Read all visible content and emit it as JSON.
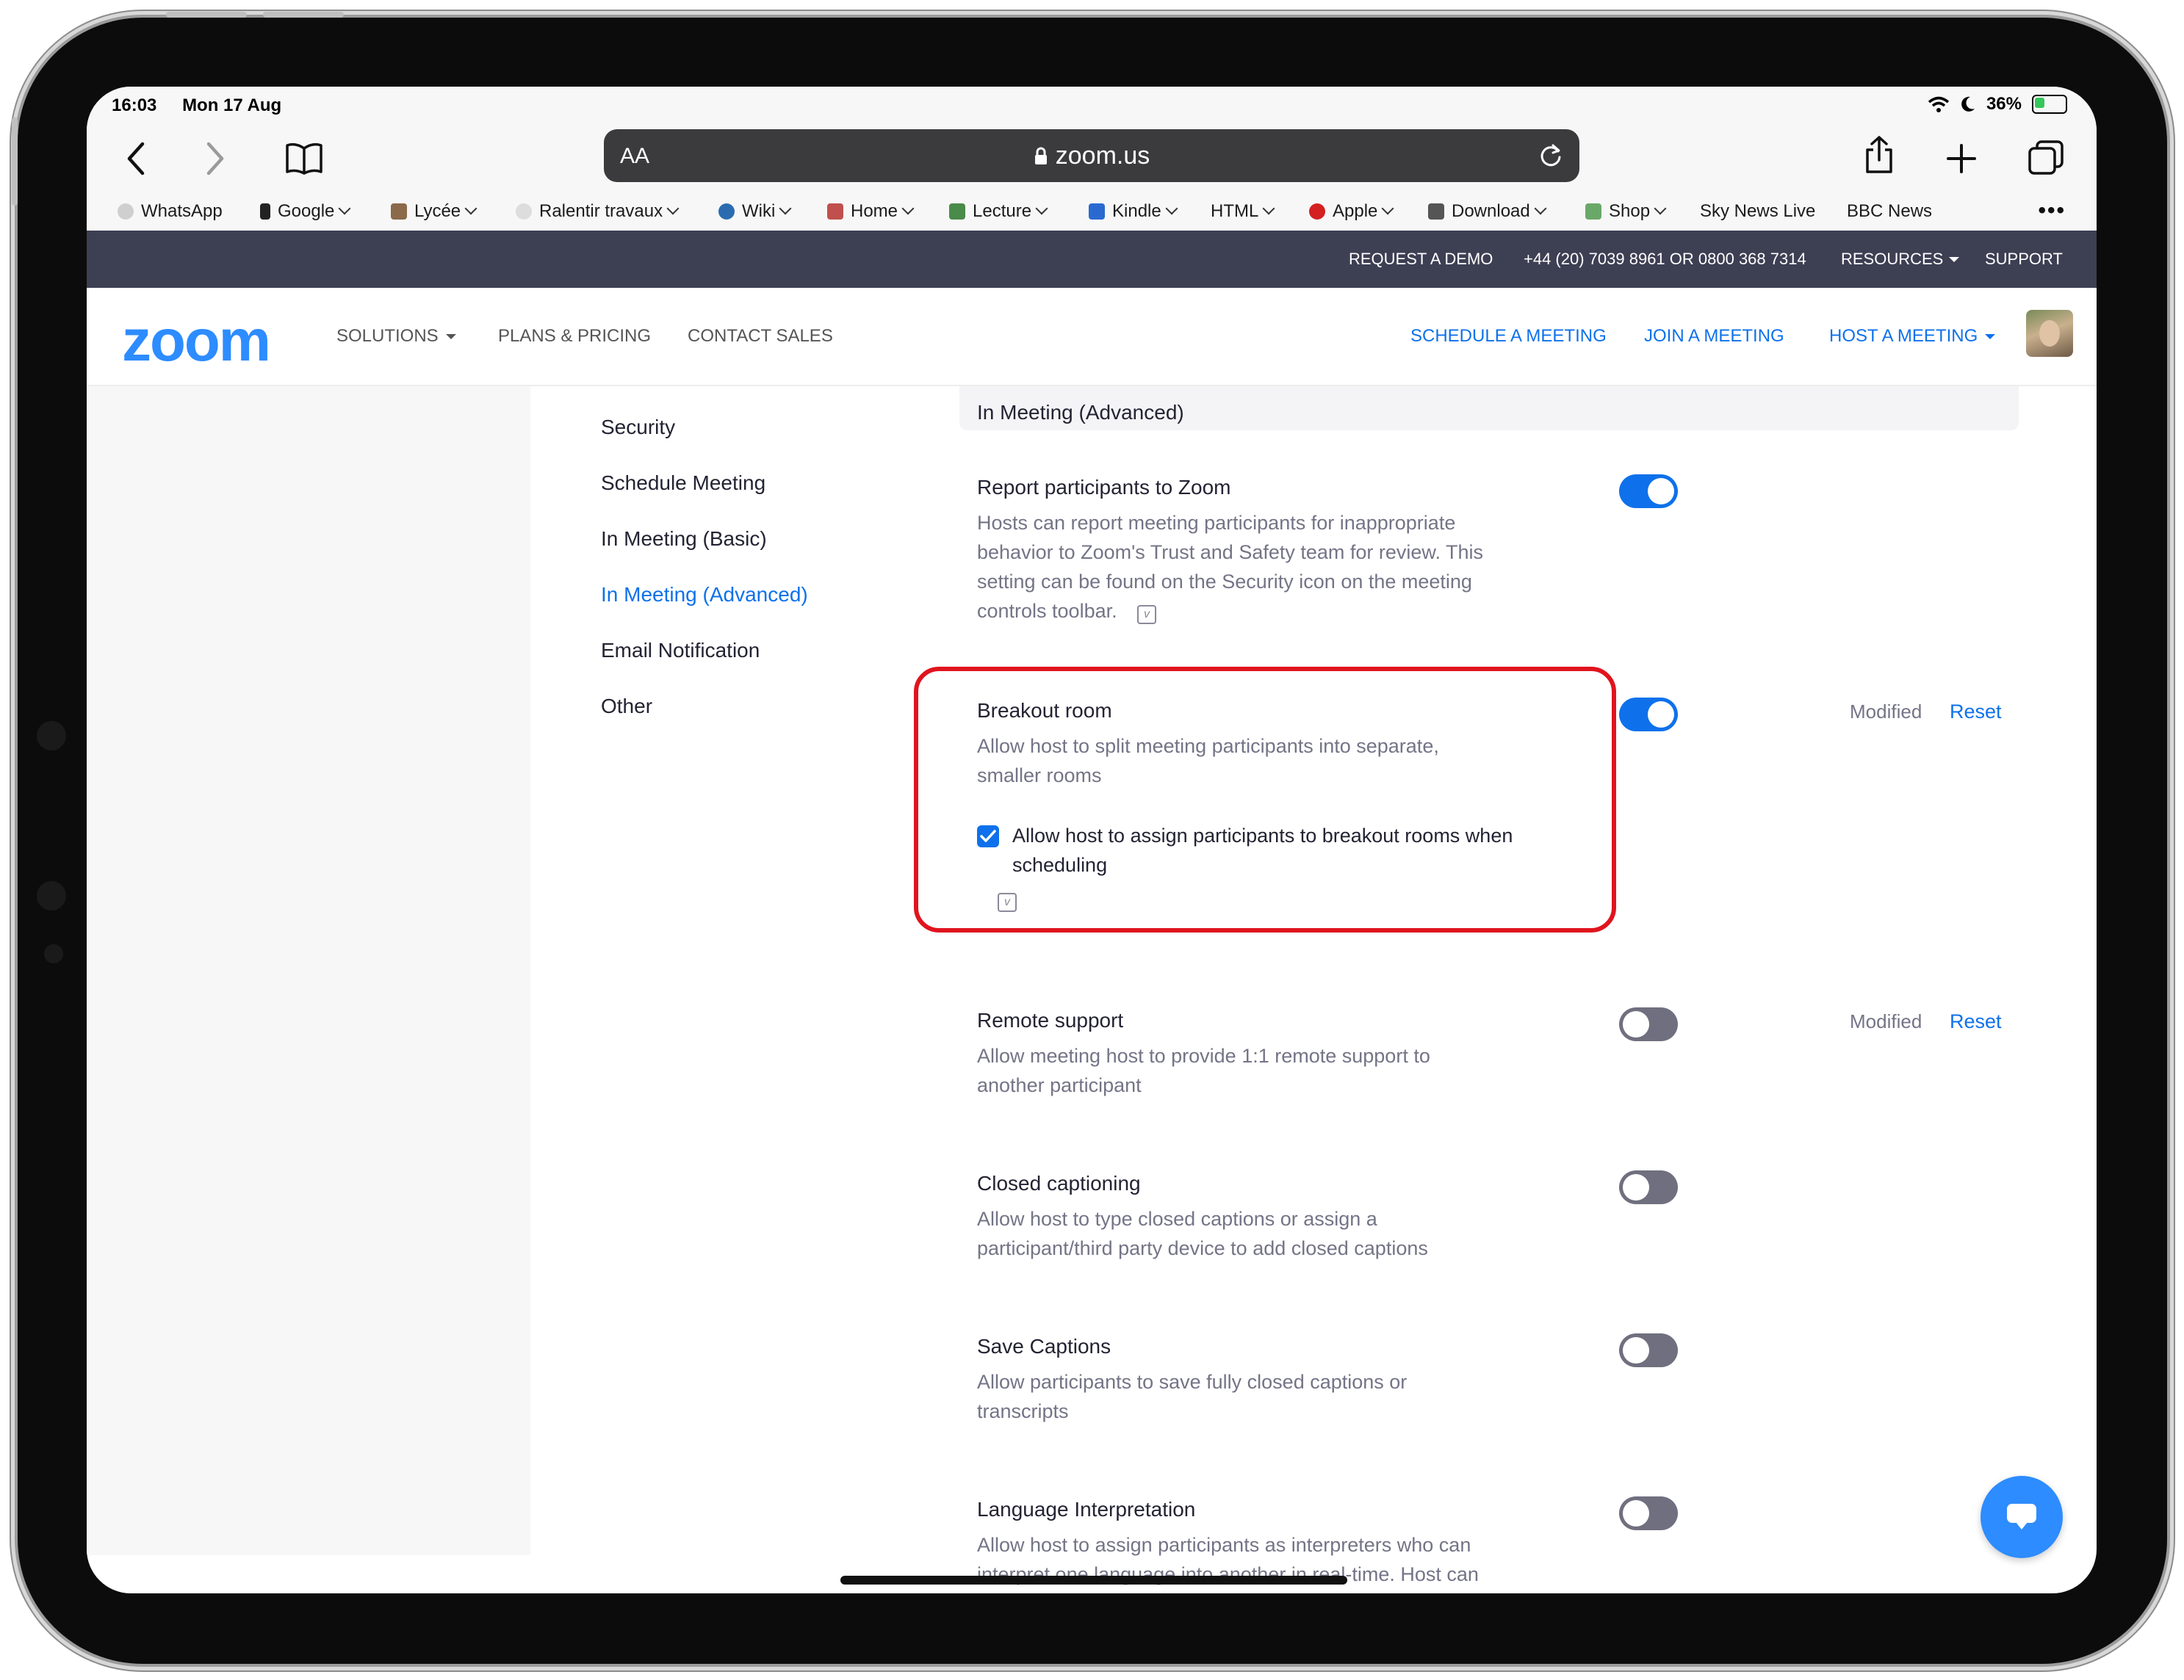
{
  "status": {
    "time": "16:03",
    "date": "Mon 17 Aug",
    "battery": "36%",
    "battery_level": 0.36
  },
  "browser": {
    "aa": "AA",
    "url": "zoom.us"
  },
  "bookmarks": [
    {
      "label": "WhatsApp",
      "icon": "whatsapp-icon",
      "color": "#cfcfcf",
      "dropdown": false
    },
    {
      "label": "Google",
      "icon": "phone-icon",
      "color": "#222222",
      "dropdown": true
    },
    {
      "label": "Lycée",
      "icon": "avatar-icon",
      "color": "#8a6a4a",
      "dropdown": true
    },
    {
      "label": "Ralentir travaux",
      "icon": "snowflake-icon",
      "color": "#dddddd",
      "dropdown": true
    },
    {
      "label": "Wiki",
      "icon": "globe-icon",
      "color": "#2b6cb0",
      "dropdown": true
    },
    {
      "label": "Home",
      "icon": "house-icon",
      "color": "#c0504d",
      "dropdown": true
    },
    {
      "label": "Lecture",
      "icon": "books-icon",
      "color": "#4a8a4a",
      "dropdown": true
    },
    {
      "label": "Kindle",
      "icon": "book-icon",
      "color": "#2a6ad0",
      "dropdown": true
    },
    {
      "label": "HTML",
      "icon": "",
      "color": "",
      "dropdown": true
    },
    {
      "label": "Apple",
      "icon": "apple-icon",
      "color": "#d42020",
      "dropdown": true
    },
    {
      "label": "Download",
      "icon": "floppy-icon",
      "color": "#555555",
      "dropdown": true
    },
    {
      "label": "Shop",
      "icon": "shop-icon",
      "color": "#6aa86a",
      "dropdown": true
    },
    {
      "label": "Sky News Live",
      "icon": "",
      "color": "",
      "dropdown": false
    },
    {
      "label": "BBC News",
      "icon": "",
      "color": "",
      "dropdown": false
    }
  ],
  "utility": {
    "demo": "REQUEST A DEMO",
    "phone": "+44 (20) 7039 8961 OR 0800 368 7314",
    "resources": "RESOURCES",
    "support": "SUPPORT"
  },
  "nav": {
    "logo": "zoom",
    "solutions": "SOLUTIONS",
    "plans": "PLANS & PRICING",
    "contact": "CONTACT SALES",
    "schedule": "SCHEDULE A MEETING",
    "join": "JOIN A MEETING",
    "host": "HOST A MEETING"
  },
  "sidebar": {
    "items": [
      "Security",
      "Schedule Meeting",
      "In Meeting (Basic)",
      "In Meeting (Advanced)",
      "Email Notification",
      "Other"
    ],
    "active": "In Meeting (Advanced)"
  },
  "section": {
    "header": "In Meeting (Advanced)"
  },
  "settings": {
    "report": {
      "title": "Report participants to Zoom",
      "desc": "Hosts can report meeting participants for inappropriate behavior to Zoom's Trust and Safety team for review. This setting can be found on the Security icon on the meeting controls toolbar.",
      "enabled": true
    },
    "breakout": {
      "title": "Breakout room",
      "desc": "Allow host to split meeting participants into separate, smaller rooms",
      "enabled": true,
      "checkbox_label": "Allow host to assign participants to breakout rooms when scheduling",
      "checkbox_checked": true,
      "modified": "Modified",
      "reset": "Reset"
    },
    "remote": {
      "title": "Remote support",
      "desc": "Allow meeting host to provide 1:1 remote support to another participant",
      "enabled": false,
      "modified": "Modified",
      "reset": "Reset"
    },
    "captioning": {
      "title": "Closed captioning",
      "desc": "Allow host to type closed captions or assign a participant/third party device to add closed captions",
      "enabled": false
    },
    "save_captions": {
      "title": "Save Captions",
      "desc": "Allow participants to save fully closed captions or transcripts",
      "enabled": false
    },
    "language": {
      "title": "Language Interpretation",
      "desc": "Allow host to assign participants as interpreters who can interpret one language into another in real-time. Host can",
      "enabled": false
    }
  },
  "colors": {
    "accent": "#0e71eb",
    "brand": "#2d8cff",
    "highlight": "#e0141e",
    "utility_bar": "#3d3f53"
  }
}
